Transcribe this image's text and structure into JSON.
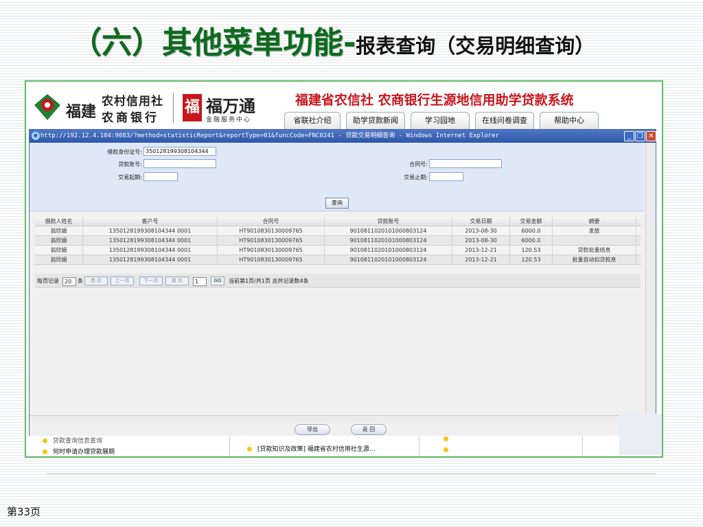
{
  "slide": {
    "title_main": "（六）其他菜单功能-",
    "title_sub": "报表查询（交易明细查询）",
    "page_number": "第33页"
  },
  "header": {
    "logo_fujian": "福建",
    "logo_line1": "农村信用社",
    "logo_line2": "农商银行",
    "fwt_name": "福万通",
    "fwt_sub": "金融服务中心",
    "system_title": "福建省农信社 农商银行生源地信用助学贷款系统",
    "nav": [
      "省联社介绍",
      "助学贷款新闻",
      "学习园地",
      "在线问卷调查",
      "帮助中心"
    ]
  },
  "ie_window": {
    "title": "http://192.12.4.104:9083/?method=statisticReport&reportType=01&funcCode=FNC0241 - 贷款交易明细查询 - Windows Internet Explorer",
    "form": {
      "id_label": "借款身份证号:",
      "id_value": "350128199308104344",
      "loan_acct_label": "贷款账号:",
      "loan_acct_value": "",
      "contract_label": "合同号:",
      "contract_value": "",
      "start_label": "交易起期:",
      "start_value": "",
      "end_label": "交易止期:",
      "end_value": "",
      "query_button": "查询"
    },
    "table": {
      "columns": [
        "借款人姓名",
        "客户号",
        "合同号",
        "贷款账号",
        "交易日期",
        "交易金额",
        "摘要"
      ],
      "rows": [
        [
          "翁欣娟",
          "1350128199308104344 0001",
          "HT9010830130009765",
          "9010811020101000803124",
          "2013-08-30",
          "6000.0",
          "发放"
        ],
        [
          "翁欣娟",
          "1350128199308104344 0001",
          "HT9010830130009765",
          "9010811020101000803124",
          "2013-08-30",
          "6000.0",
          ""
        ],
        [
          "翁欣娟",
          "1350128199308104344 0001",
          "HT9010830130009765",
          "9010811020101000803124",
          "2013-12-21",
          "120.53",
          "贷款批量结息"
        ],
        [
          "翁欣娟",
          "1350128199308104344 0001",
          "HT9010830130009765",
          "9010811020101000803124",
          "2013-12-21",
          "120.53",
          "批量自动扣贷款息"
        ]
      ]
    },
    "pager": {
      "per_page_label": "每页记录",
      "per_page_value": "20",
      "per_page_unit": "条",
      "first": "首 页",
      "prev": "上一页",
      "next": "下一页",
      "last": "尾 页",
      "page_value": "1",
      "go": "GO",
      "summary": "当前第1页/共1页 总共记录数4条"
    },
    "buttons": {
      "export": "导出",
      "back": "返 回"
    }
  },
  "background_list": {
    "item1": "贷款查询信息查询",
    "item2": "何时申请办理贷款展期",
    "item3": "[贷款知识及政策] 福建省农村信用社生源..."
  }
}
